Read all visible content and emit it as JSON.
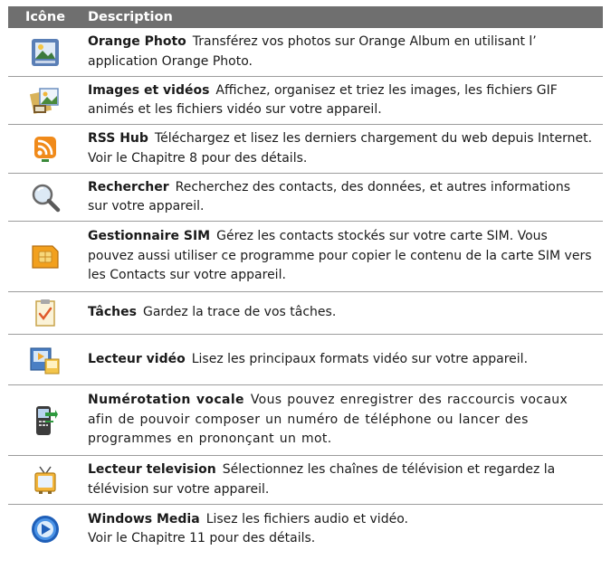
{
  "header": {
    "col_icon": "Icône",
    "col_description": "Description"
  },
  "rows": [
    {
      "icon": "photo-icon",
      "title": "Orange Photo",
      "text": "Transférez vos photos sur Orange Album en utilisant l’ application Orange Photo."
    },
    {
      "icon": "pictures-videos-icon",
      "title": "Images et vidéos",
      "text": "Affichez, organisez et triez les images, les fichiers GIF animés et les fichiers vidéo sur votre appareil."
    },
    {
      "icon": "rss-icon",
      "title": "RSS Hub",
      "text": "Téléchargez et lisez les derniers chargement du web depuis Internet. Voir le Chapitre 8 pour des détails."
    },
    {
      "icon": "search-icon",
      "title": "Rechercher",
      "text": "Recherchez des contacts, des données, et autres informations sur votre appareil."
    },
    {
      "icon": "sim-card-icon",
      "title": "Gestionnaire SIM",
      "text": "Gérez les contacts stockés sur votre carte SIM. Vous pouvez aussi utiliser ce programme pour copier le contenu de la carte SIM vers les Contacts sur votre appareil."
    },
    {
      "icon": "tasks-icon",
      "title": "Tâches",
      "text": "Gardez la trace de vos tâches."
    },
    {
      "icon": "video-player-icon",
      "title": "Lecteur vidéo",
      "text": "Lisez les principaux formats vidéo sur votre appareil."
    },
    {
      "icon": "voice-dial-icon",
      "title": "Numérotation vocale",
      "text": "Vous pouvez enregistrer des raccourcis vocaux afin de pouvoir composer un numéro de téléphone ou lancer des programmes en prononçant un mot."
    },
    {
      "icon": "tv-icon",
      "title": "Lecteur television",
      "text": "Sélectionnez les chaînes de télévision et regardez la télévision sur votre appareil."
    },
    {
      "icon": "windows-media-icon",
      "title": "Windows Media",
      "text": "Lisez les fichiers audio et vidéo.",
      "text2": "Voir le Chapitre 11 pour des détails."
    }
  ]
}
